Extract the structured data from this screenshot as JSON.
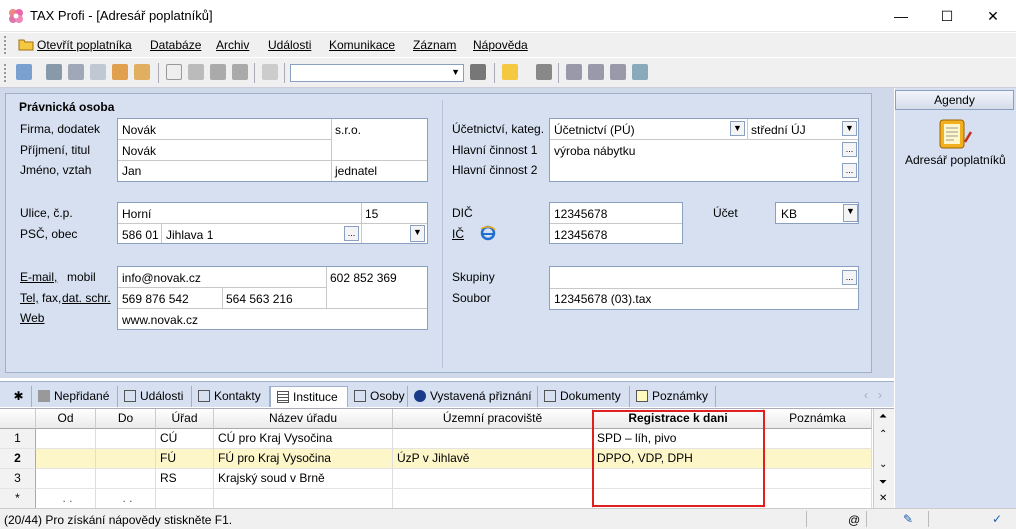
{
  "window": {
    "title": "TAX Profi - [Adresář poplatníků]",
    "minimize": "—",
    "maximize": "☐",
    "close": "✕"
  },
  "menu": [
    "Otevřít poplatníka",
    "Databáze",
    "Archiv",
    "Události",
    "Komunikace",
    "Záznam",
    "Nápověda"
  ],
  "form": {
    "section_title": "Právnická osoba",
    "firma_label": "Firma, dodatek",
    "firma": "Novák",
    "dodatek": "s.r.o.",
    "prijmeni_label": "Příjmení, titul",
    "prijmeni": "Novák",
    "jmeno_label": "Jméno, vztah",
    "jmeno": "Jan",
    "vztah": "jednatel",
    "ulice_label": "Ulice, č.p.",
    "ulice": "Horní",
    "cp": "15",
    "psc_label": "PSČ, obec",
    "psc": "586 01",
    "obec": "Jihlava 1",
    "email_label": "E-mail,",
    "mobil_label": "mobil",
    "email": "info@novak.cz",
    "mobil": "602 852 369",
    "tel_label": "Tel,",
    "fax_label": "fax,",
    "datschr_label": "dat. schr.",
    "tel": "569 876 542",
    "fax": "564 563 216",
    "web_label": "Web",
    "web": "www.novak.cz",
    "ucetnictvi_label": "Účetnictví, kateg.",
    "ucetnictvi": "Účetnictví (PÚ)",
    "kategorie": "střední ÚJ",
    "cinnost1_label": "Hlavní činnost 1",
    "cinnost1": "výroba nábytku",
    "cinnost2_label": "Hlavní činnost 2",
    "dic_label": "DIČ",
    "dic": "12345678",
    "ucet_label": "Účet",
    "ucet": "KB",
    "ic_label": "IČ",
    "ic": "12345678",
    "skupiny_label": "Skupiny",
    "soubor_label": "Soubor",
    "soubor": "12345678 (03).tax",
    "ellipsis": "...",
    "arrow_down": "▼"
  },
  "agendy": {
    "header": "Agendy",
    "item": "Adresář poplatníků"
  },
  "tabs": [
    "✱",
    "Nepřidané",
    "Události",
    "Kontakty",
    "Instituce",
    "Osoby",
    "Vystavená přiznání",
    "Dokumenty",
    "Poznámky"
  ],
  "tabs_nav": [
    "‹",
    "›"
  ],
  "grid": {
    "columns": [
      "Od",
      "Do",
      "Úřad",
      "Název úřadu",
      "Územní pracoviště",
      "Registrace k dani",
      "Poznámka"
    ],
    "rows": [
      {
        "num": "1",
        "od": "",
        "do": "",
        "urad": "CÚ",
        "nazev": "CÚ pro Kraj Vysočina",
        "up": "",
        "reg": "SPD – líh, pivo",
        "pozn": ""
      },
      {
        "num": "2",
        "od": "",
        "do": "",
        "urad": "FÚ",
        "nazev": "FÚ pro Kraj Vysočina",
        "up": "ÚzP v Jihlavě",
        "reg": "DPPO, VDP, DPH",
        "pozn": ""
      },
      {
        "num": "3",
        "od": "",
        "do": "",
        "urad": "RS",
        "nazev": "Krajský soud v Brně",
        "up": "",
        "reg": "",
        "pozn": ""
      },
      {
        "num": "*",
        "od": ". .",
        "do": ". .",
        "urad": "",
        "nazev": "",
        "up": "",
        "reg": "",
        "pozn": ""
      }
    ]
  },
  "status": {
    "text": "(20/44)  Pro získání nápovědy stiskněte F1.",
    "at": "@",
    "check": "✓"
  },
  "colors": {
    "panel": "#d6e0f0",
    "highlight": "#e02020",
    "selected_row": "#fdf6c8"
  }
}
